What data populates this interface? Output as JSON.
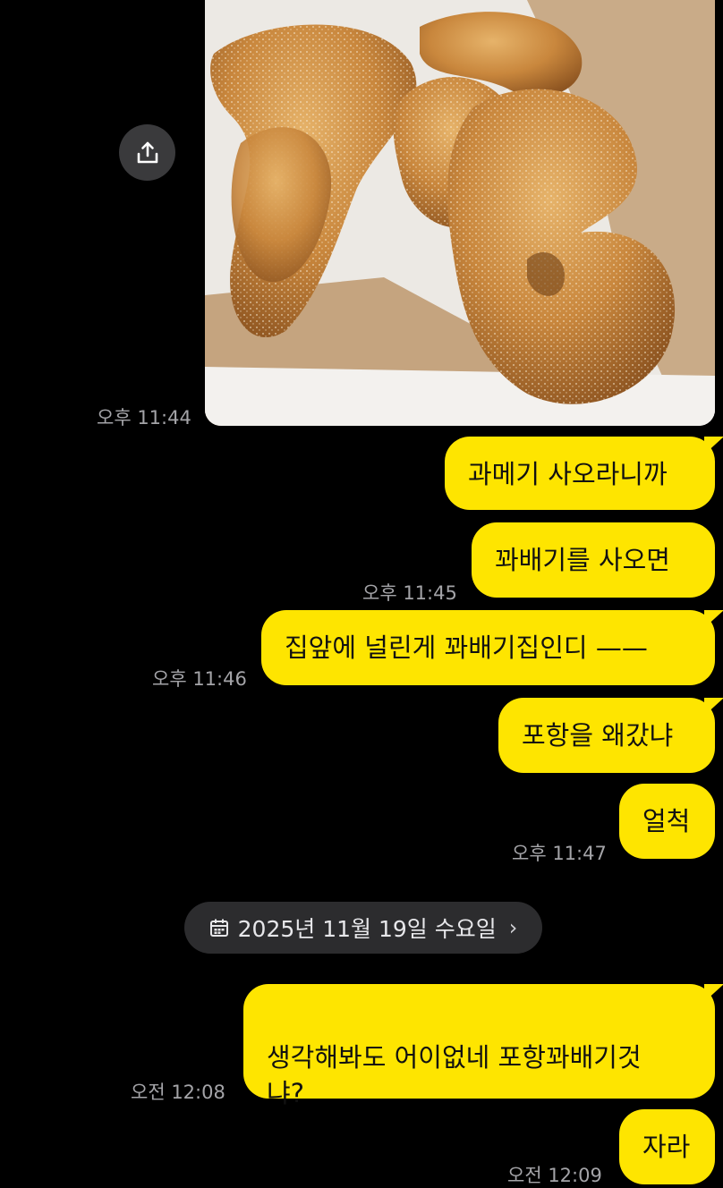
{
  "photo": {
    "subject": "sugar-coated twisted donuts (kkwabaegi) in brown paper bag",
    "time": "오후 11:44"
  },
  "share_icon": "share-upload-icon",
  "messages": [
    {
      "text": "과메기 사오라니까",
      "time": ""
    },
    {
      "text": "꽈배기를 사오면",
      "time": "오후 11:45"
    },
    {
      "text": "집앞에 널린게 꽈배기집인디 ——",
      "time": "오후 11:46"
    },
    {
      "text": "포항을 왜갔냐",
      "time": ""
    },
    {
      "text": "얼척",
      "time": "오후 11:47"
    },
    {
      "text": "생각해봐도 어이없네 포항꽈배기것\n냐?",
      "time": "오전 12:08"
    },
    {
      "text": "자라",
      "time": "오전 12:09"
    }
  ],
  "date_divider": {
    "icon": "calendar-icon",
    "label": "2025년 11월 19일 수요일",
    "chevron": "›"
  },
  "colors": {
    "background": "#000000",
    "bubble": "#fee500",
    "timestamp": "#a4a4a8",
    "pill": "#2c2c2e"
  }
}
